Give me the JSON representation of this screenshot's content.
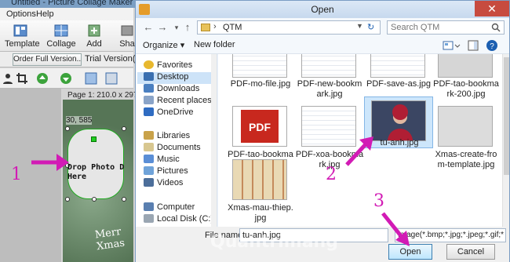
{
  "background_app": {
    "title": "Untitled - Picture Collage Maker",
    "menu": [
      "Options",
      "Help"
    ],
    "toolbar": [
      "Template",
      "Collage",
      "Add",
      "Sha"
    ],
    "order_button": "Order Full Version...",
    "trial_text": "Trial Version(15",
    "page_info": "Page 1: 210.0 x 297.0",
    "coord_label": "30, 585",
    "drop_text": "Drop Photo D\nHere",
    "xmas_text": "Merr\nXmas"
  },
  "annotations": {
    "step1": "1",
    "step2": "2",
    "step3": "3",
    "color": "#d21bb5"
  },
  "dialog": {
    "title": "Open",
    "close_label": "✕",
    "address": {
      "path": "QTM",
      "separator": "›"
    },
    "search_placeholder": "Search QTM",
    "commands": {
      "organize": "Organize ▾",
      "new_folder": "New folder"
    },
    "nav_items": [
      {
        "label": "Favorites",
        "icon": "star-icon",
        "color": "#e8b82e"
      },
      {
        "label": "Desktop",
        "icon": "desktop-icon",
        "color": "#3a6fb0",
        "selected": true
      },
      {
        "label": "Downloads",
        "icon": "downloads-icon",
        "color": "#4a7fc0"
      },
      {
        "label": "Recent places",
        "icon": "recent-places-icon",
        "color": "#8aa4c8"
      },
      {
        "label": "OneDrive",
        "icon": "onedrive-icon",
        "color": "#2f6cc2"
      },
      {
        "label": "Libraries",
        "icon": "libraries-icon",
        "color": "#c9a24a"
      },
      {
        "label": "Documents",
        "icon": "documents-icon",
        "color": "#d8c790"
      },
      {
        "label": "Music",
        "icon": "music-icon",
        "color": "#5a8ed6"
      },
      {
        "label": "Pictures",
        "icon": "pictures-icon",
        "color": "#6fa3d9"
      },
      {
        "label": "Videos",
        "icon": "videos-icon",
        "color": "#4c6e9a"
      },
      {
        "label": "Computer",
        "icon": "computer-icon",
        "color": "#5a7fb0"
      },
      {
        "label": "Local Disk (C:)",
        "icon": "disk-icon",
        "color": "#9aa6b2"
      }
    ],
    "files": [
      {
        "name": "PDF-mo-file.jpg",
        "thumb": "doc"
      },
      {
        "name": "PDF-new-bookm\nark.jpg",
        "thumb": "doc"
      },
      {
        "name": "PDF-save-as.jpg",
        "thumb": "doc"
      },
      {
        "name": "PDF-tao-bookma\nrk-200.jpg",
        "thumb": "gray"
      },
      {
        "name": "PDF-tao-bookma\nrk-650.jpg",
        "thumb": "pdf"
      },
      {
        "name": "PDF-xoa-bookma\nrk.jpg",
        "thumb": "doc"
      },
      {
        "name": "tu-anh.jpg",
        "thumb": "photo",
        "selected": true
      },
      {
        "name": "Xmas-create-fro\nm-template.jpg",
        "thumb": "gray"
      },
      {
        "name": "Xmas-mau-thiep.\njpg",
        "thumb": "collage"
      }
    ],
    "file_name_label": "File name:",
    "file_name_value": "tu-anh.jpg",
    "filter": "Image(*.bmp;*.jpg;*.jpeg;*.gif;*",
    "open_label": "Open",
    "cancel_label": "Cancel",
    "watermark": "Quantrimang"
  }
}
